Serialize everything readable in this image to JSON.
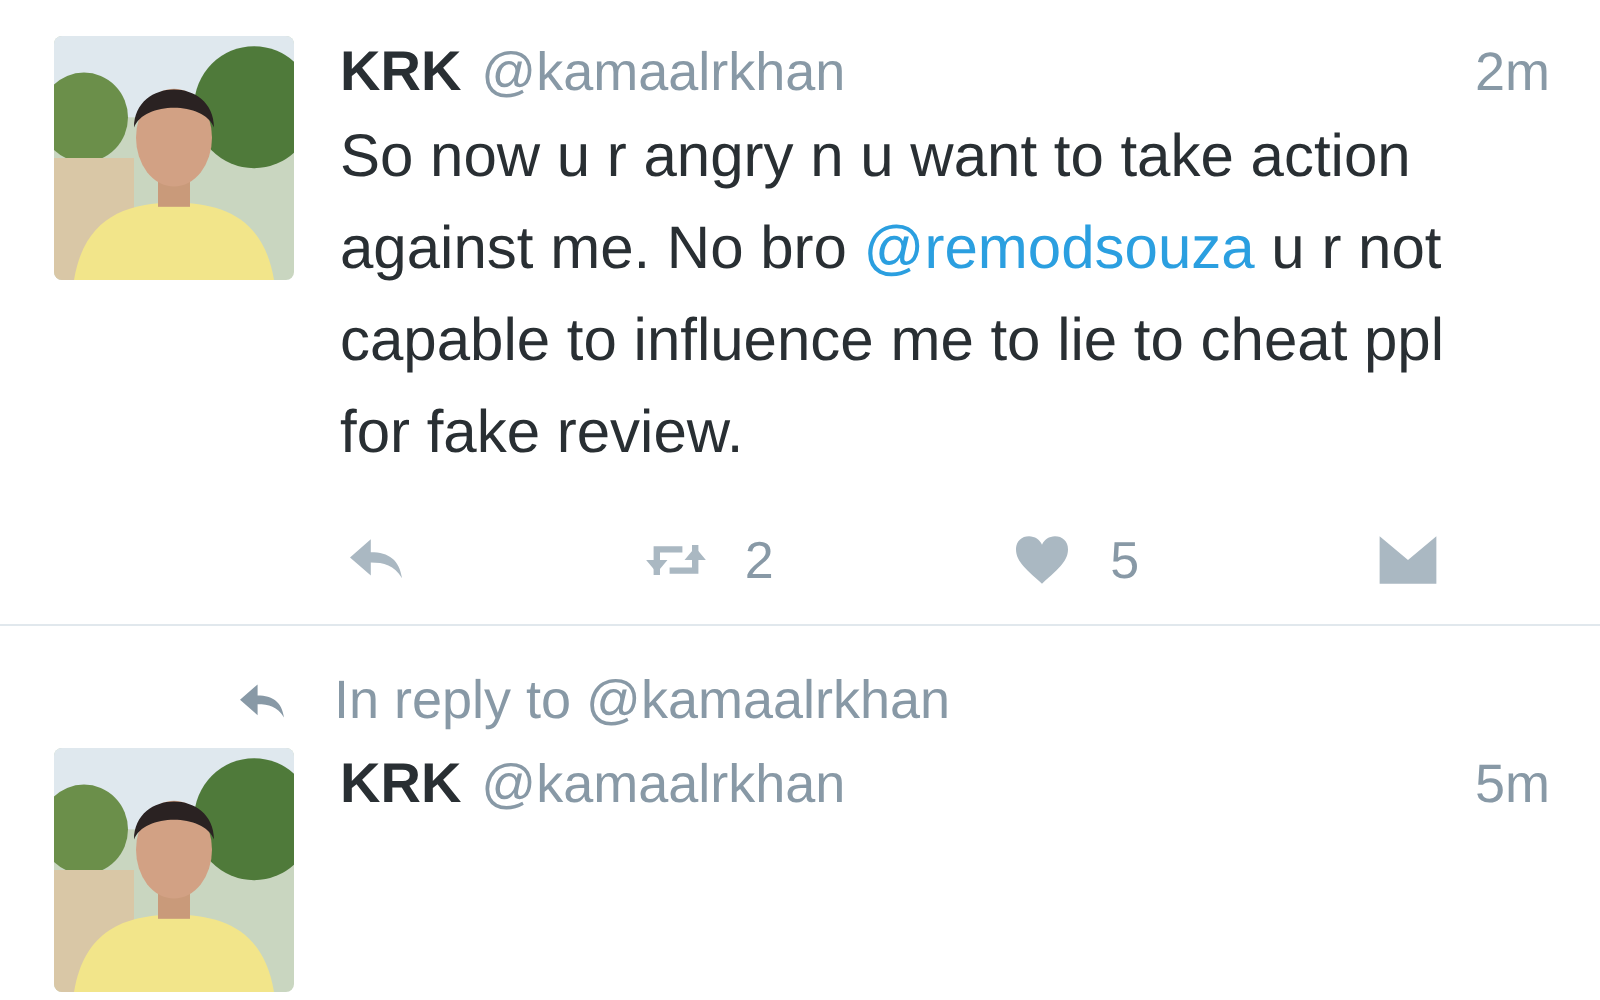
{
  "tweets": [
    {
      "name": "KRK",
      "handle": "@kamaalrkhan",
      "time": "2m",
      "text_parts": [
        {
          "kind": "plain",
          "text": "So now u r angry n u want to take action against me. No bro "
        },
        {
          "kind": "mention",
          "text": "@remodsouza"
        },
        {
          "kind": "plain",
          "text": " u r not capable to influence me to lie to cheat ppl for fake review."
        }
      ],
      "retweets": "2",
      "likes": "5"
    },
    {
      "in_reply_to": "In reply to @kamaalrkhan",
      "name": "KRK",
      "handle": "@kamaalrkhan",
      "time": "5m"
    }
  ]
}
